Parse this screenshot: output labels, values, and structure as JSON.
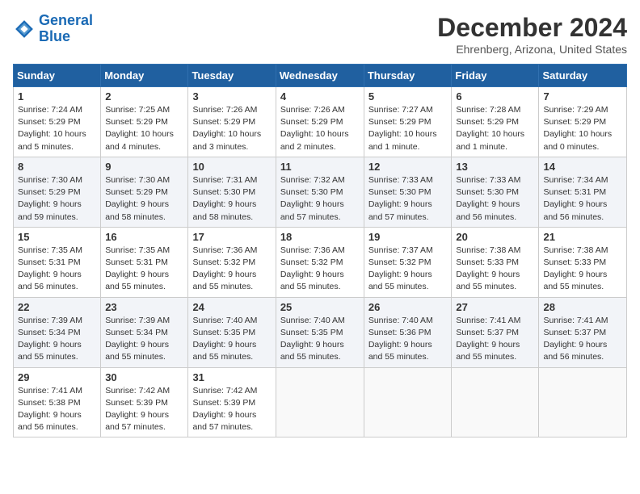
{
  "header": {
    "logo_line1": "General",
    "logo_line2": "Blue",
    "month": "December 2024",
    "location": "Ehrenberg, Arizona, United States"
  },
  "weekdays": [
    "Sunday",
    "Monday",
    "Tuesday",
    "Wednesday",
    "Thursday",
    "Friday",
    "Saturday"
  ],
  "weeks": [
    [
      {
        "day": "1",
        "sunrise": "7:24 AM",
        "sunset": "5:29 PM",
        "daylight": "10 hours and 5 minutes."
      },
      {
        "day": "2",
        "sunrise": "7:25 AM",
        "sunset": "5:29 PM",
        "daylight": "10 hours and 4 minutes."
      },
      {
        "day": "3",
        "sunrise": "7:26 AM",
        "sunset": "5:29 PM",
        "daylight": "10 hours and 3 minutes."
      },
      {
        "day": "4",
        "sunrise": "7:26 AM",
        "sunset": "5:29 PM",
        "daylight": "10 hours and 2 minutes."
      },
      {
        "day": "5",
        "sunrise": "7:27 AM",
        "sunset": "5:29 PM",
        "daylight": "10 hours and 1 minute."
      },
      {
        "day": "6",
        "sunrise": "7:28 AM",
        "sunset": "5:29 PM",
        "daylight": "10 hours and 1 minute."
      },
      {
        "day": "7",
        "sunrise": "7:29 AM",
        "sunset": "5:29 PM",
        "daylight": "10 hours and 0 minutes."
      }
    ],
    [
      {
        "day": "8",
        "sunrise": "7:30 AM",
        "sunset": "5:29 PM",
        "daylight": "9 hours and 59 minutes."
      },
      {
        "day": "9",
        "sunrise": "7:30 AM",
        "sunset": "5:29 PM",
        "daylight": "9 hours and 58 minutes."
      },
      {
        "day": "10",
        "sunrise": "7:31 AM",
        "sunset": "5:30 PM",
        "daylight": "9 hours and 58 minutes."
      },
      {
        "day": "11",
        "sunrise": "7:32 AM",
        "sunset": "5:30 PM",
        "daylight": "9 hours and 57 minutes."
      },
      {
        "day": "12",
        "sunrise": "7:33 AM",
        "sunset": "5:30 PM",
        "daylight": "9 hours and 57 minutes."
      },
      {
        "day": "13",
        "sunrise": "7:33 AM",
        "sunset": "5:30 PM",
        "daylight": "9 hours and 56 minutes."
      },
      {
        "day": "14",
        "sunrise": "7:34 AM",
        "sunset": "5:31 PM",
        "daylight": "9 hours and 56 minutes."
      }
    ],
    [
      {
        "day": "15",
        "sunrise": "7:35 AM",
        "sunset": "5:31 PM",
        "daylight": "9 hours and 56 minutes."
      },
      {
        "day": "16",
        "sunrise": "7:35 AM",
        "sunset": "5:31 PM",
        "daylight": "9 hours and 55 minutes."
      },
      {
        "day": "17",
        "sunrise": "7:36 AM",
        "sunset": "5:32 PM",
        "daylight": "9 hours and 55 minutes."
      },
      {
        "day": "18",
        "sunrise": "7:36 AM",
        "sunset": "5:32 PM",
        "daylight": "9 hours and 55 minutes."
      },
      {
        "day": "19",
        "sunrise": "7:37 AM",
        "sunset": "5:32 PM",
        "daylight": "9 hours and 55 minutes."
      },
      {
        "day": "20",
        "sunrise": "7:38 AM",
        "sunset": "5:33 PM",
        "daylight": "9 hours and 55 minutes."
      },
      {
        "day": "21",
        "sunrise": "7:38 AM",
        "sunset": "5:33 PM",
        "daylight": "9 hours and 55 minutes."
      }
    ],
    [
      {
        "day": "22",
        "sunrise": "7:39 AM",
        "sunset": "5:34 PM",
        "daylight": "9 hours and 55 minutes."
      },
      {
        "day": "23",
        "sunrise": "7:39 AM",
        "sunset": "5:34 PM",
        "daylight": "9 hours and 55 minutes."
      },
      {
        "day": "24",
        "sunrise": "7:40 AM",
        "sunset": "5:35 PM",
        "daylight": "9 hours and 55 minutes."
      },
      {
        "day": "25",
        "sunrise": "7:40 AM",
        "sunset": "5:35 PM",
        "daylight": "9 hours and 55 minutes."
      },
      {
        "day": "26",
        "sunrise": "7:40 AM",
        "sunset": "5:36 PM",
        "daylight": "9 hours and 55 minutes."
      },
      {
        "day": "27",
        "sunrise": "7:41 AM",
        "sunset": "5:37 PM",
        "daylight": "9 hours and 55 minutes."
      },
      {
        "day": "28",
        "sunrise": "7:41 AM",
        "sunset": "5:37 PM",
        "daylight": "9 hours and 56 minutes."
      }
    ],
    [
      {
        "day": "29",
        "sunrise": "7:41 AM",
        "sunset": "5:38 PM",
        "daylight": "9 hours and 56 minutes."
      },
      {
        "day": "30",
        "sunrise": "7:42 AM",
        "sunset": "5:39 PM",
        "daylight": "9 hours and 57 minutes."
      },
      {
        "day": "31",
        "sunrise": "7:42 AM",
        "sunset": "5:39 PM",
        "daylight": "9 hours and 57 minutes."
      },
      null,
      null,
      null,
      null
    ]
  ]
}
